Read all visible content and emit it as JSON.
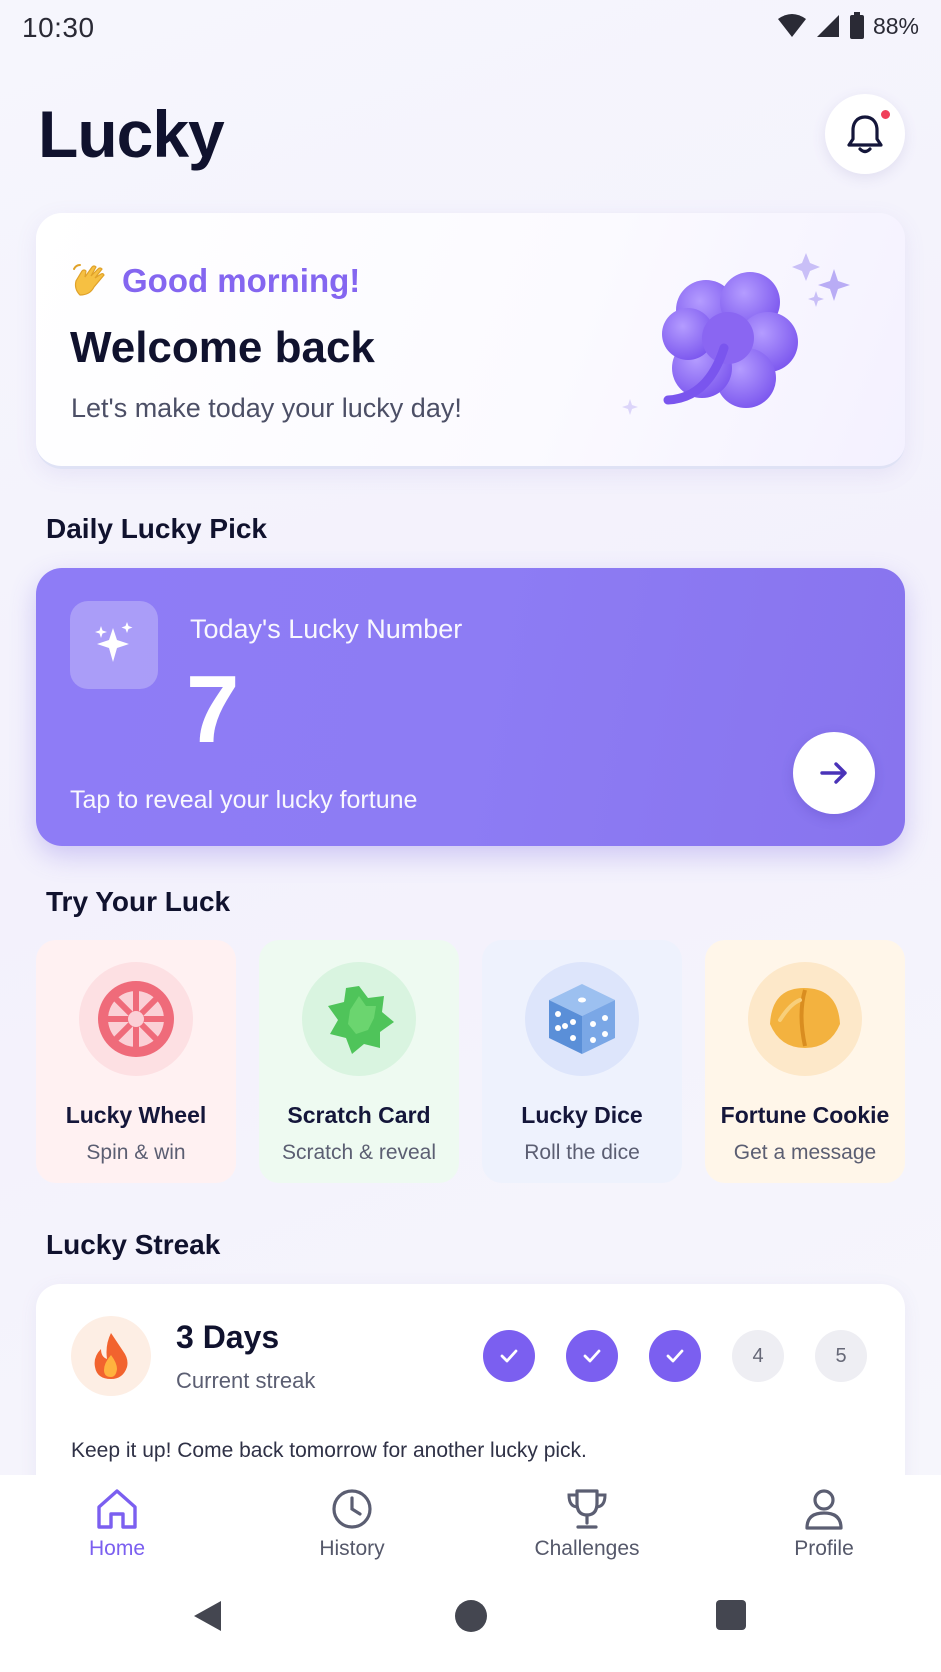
{
  "status_bar": {
    "time": "10:30",
    "battery": "88%"
  },
  "app": {
    "title": "Lucky"
  },
  "welcome": {
    "greeting": "Good morning!",
    "title": "Welcome back",
    "subtitle": "Let's make today your lucky day!"
  },
  "daily_pick": {
    "section_title": "Daily Lucky Pick",
    "label": "Today's Lucky Number",
    "number": "7",
    "subtitle": "Tap to reveal your lucky fortune"
  },
  "try_luck": {
    "section_title": "Try Your Luck",
    "games": [
      {
        "title": "Lucky Wheel",
        "subtitle": "Spin & win",
        "icon": "wheel-icon"
      },
      {
        "title": "Scratch Card",
        "subtitle": "Scratch & reveal",
        "icon": "scratch-card-icon"
      },
      {
        "title": "Lucky Dice",
        "subtitle": "Roll the dice",
        "icon": "dice-icon"
      },
      {
        "title": "Fortune Cookie",
        "subtitle": "Get a message",
        "icon": "fortune-cookie-icon"
      }
    ]
  },
  "streak": {
    "section_title": "Lucky Streak",
    "days": "3 Days",
    "label": "Current streak",
    "steps": [
      "",
      "",
      "",
      "4",
      "5"
    ],
    "completed": 3,
    "note": "Keep it up! Come back tomorrow for another lucky pick."
  },
  "nav": {
    "items": [
      {
        "label": "Home",
        "icon": "home-icon",
        "active": true
      },
      {
        "label": "History",
        "icon": "clock-icon",
        "active": false
      },
      {
        "label": "Challenges",
        "icon": "trophy-icon",
        "active": false
      },
      {
        "label": "Profile",
        "icon": "user-icon",
        "active": false
      }
    ]
  },
  "colors": {
    "accent": "#7b5ff0",
    "pick_card": "#8e7cf6",
    "text_dark": "#10122e",
    "notification_dot": "#f0405a"
  }
}
